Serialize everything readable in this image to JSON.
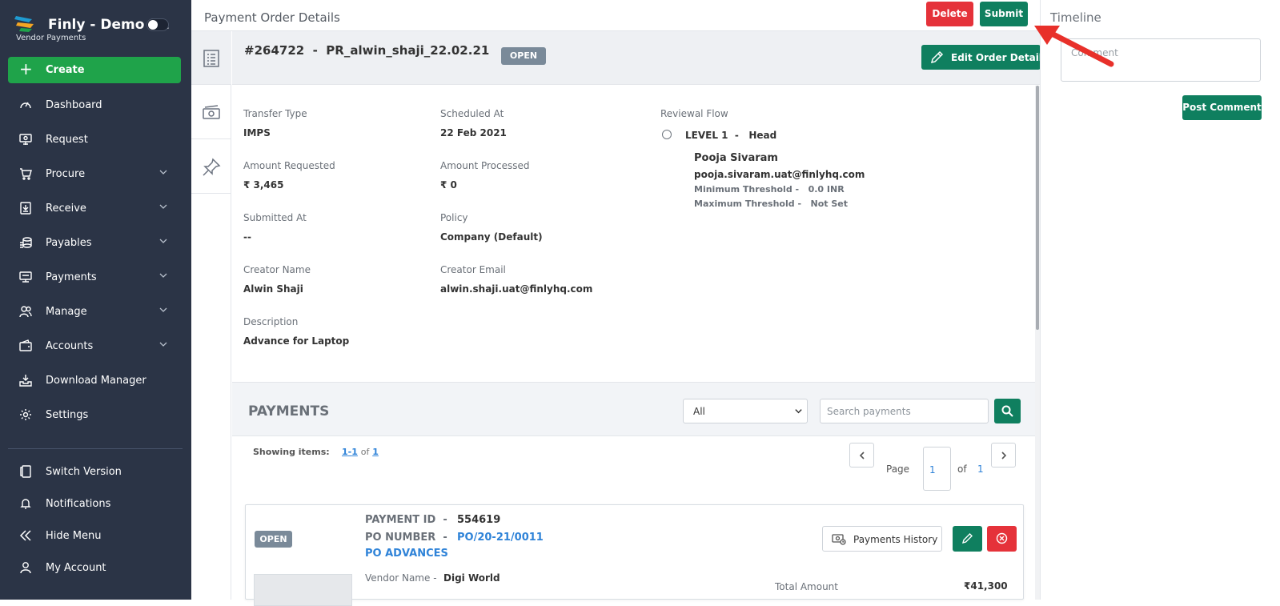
{
  "sidebar": {
    "app_name": "Finly - Demo f...",
    "app_subtitle": "Vendor Payments",
    "create_label": "Create",
    "items": [
      {
        "label": "Dashboard",
        "icon": "dashboard-icon",
        "has_chevron": false
      },
      {
        "label": "Request",
        "icon": "request-icon",
        "has_chevron": false
      },
      {
        "label": "Procure",
        "icon": "cart-icon",
        "has_chevron": true
      },
      {
        "label": "Receive",
        "icon": "download-icon",
        "has_chevron": true
      },
      {
        "label": "Payables",
        "icon": "coins-icon",
        "has_chevron": true
      },
      {
        "label": "Payments",
        "icon": "monitor-icon",
        "has_chevron": true
      },
      {
        "label": "Manage",
        "icon": "users-icon",
        "has_chevron": true
      },
      {
        "label": "Accounts",
        "icon": "wallet-icon",
        "has_chevron": true
      },
      {
        "label": "Download Manager",
        "icon": "tray-icon",
        "has_chevron": false
      },
      {
        "label": "Settings",
        "icon": "gear-icon",
        "has_chevron": false
      }
    ],
    "bottom_items": [
      {
        "label": "Switch Version",
        "icon": "switch-icon"
      },
      {
        "label": "Notifications",
        "icon": "bell-icon"
      },
      {
        "label": "Hide Menu",
        "icon": "double-chevron-left-icon"
      },
      {
        "label": "My Account",
        "icon": "user-icon"
      }
    ]
  },
  "header": {
    "title": "Payment Order Details",
    "delete_label": "Delete",
    "submit_label": "Submit"
  },
  "order": {
    "id_line": "#264722  -  PR_alwin_shaji_22.02.21",
    "status": "OPEN",
    "edit_label": "Edit Order Details",
    "fields": {
      "transfer_type": {
        "label": "Transfer Type",
        "value": "IMPS"
      },
      "scheduled_at": {
        "label": "Scheduled At",
        "value": "22 Feb 2021"
      },
      "amount_requested": {
        "label": "Amount Requested",
        "value": "₹ 3,465"
      },
      "amount_processed": {
        "label": "Amount Processed",
        "value": "₹ 0"
      },
      "submitted_at": {
        "label": "Submitted At",
        "value": "--"
      },
      "policy": {
        "label": "Policy",
        "value": "Company (Default)"
      },
      "creator_name": {
        "label": "Creator Name",
        "value": "Alwin Shaji"
      },
      "creator_email": {
        "label": "Creator Email",
        "value": "alwin.shaji.uat@finlyhq.com"
      },
      "description": {
        "label": "Description",
        "value": "Advance for Laptop"
      }
    },
    "reviewal": {
      "label": "Reviewal Flow",
      "level": "LEVEL 1  -   Head",
      "approver_name": "Pooja Sivaram",
      "approver_email": "pooja.sivaram.uat@finlyhq.com",
      "min_threshold": "Minimum Threshold -   0.0 INR",
      "max_threshold": "Maximum Threshold -   Not Set"
    }
  },
  "payments": {
    "title": "PAYMENTS",
    "filter_value": "All",
    "search_placeholder": "Search payments",
    "showing_label": "Showing items:",
    "range_start": "1",
    "range_sep": "-",
    "range_end": "1",
    "of_label": "of",
    "total": "1",
    "page_label": "Page",
    "page_value": "1",
    "page_of": "of",
    "page_total": "1",
    "card": {
      "status": "OPEN",
      "payment_id_label": "PAYMENT ID  -",
      "payment_id": "554619",
      "po_number_label": "PO NUMBER  -",
      "po_number": "PO/20-21/0011",
      "po_type": "PO ADVANCES",
      "vendor_label": "Vendor Name  -",
      "vendor": "Digi World",
      "total_label": "Total Amount",
      "total_value": "₹41,300",
      "history_label": "Payments History"
    }
  },
  "timeline": {
    "title": "Timeline",
    "comment_placeholder": "Comment",
    "post_label": "Post Comment"
  },
  "colors": {
    "sidebar_bg": "#2b3446",
    "create_green": "#1fa34a",
    "primary_green": "#0f7f5f",
    "danger_red": "#e5323a",
    "link_blue": "#2f83d8",
    "badge_grey": "#7a8a99",
    "annotation_arrow": "#e8302a"
  }
}
